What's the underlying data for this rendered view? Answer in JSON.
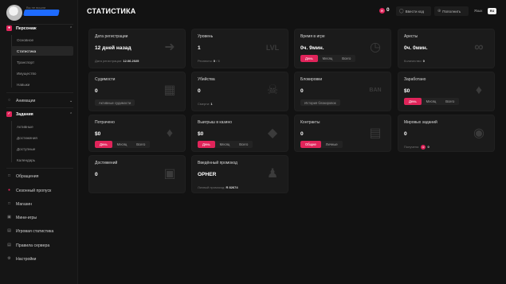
{
  "profile": {
    "status": "Вы не вошли"
  },
  "sidebar": {
    "groups": [
      {
        "label": "Персонаж",
        "icon": "user-icon",
        "expanded": true,
        "items": [
          "Основное",
          "Статистика",
          "Транспорт",
          "Имущество",
          "Навыки"
        ],
        "selected": "Статистика"
      },
      {
        "label": "Анимации",
        "icon": "animation-icon",
        "expanded": false
      },
      {
        "label": "Задания",
        "icon": "tasks-icon",
        "expanded": true,
        "items": [
          "Активные",
          "Достижения",
          "Доступные",
          "Календарь"
        ]
      },
      {
        "label": "Обращения",
        "icon": "ticket-icon"
      },
      {
        "label": "Сезонный пропуск",
        "icon": "pass-icon"
      },
      {
        "label": "Магазин",
        "icon": "shop-icon"
      },
      {
        "label": "Мини-игры",
        "icon": "gamepad-icon"
      },
      {
        "label": "Игровая статистика",
        "icon": "stats-icon"
      },
      {
        "label": "Правила сервера",
        "icon": "rules-icon"
      },
      {
        "label": "Настройки",
        "icon": "settings-icon"
      }
    ]
  },
  "header": {
    "title": "СТАТИСТИКА",
    "coins": "0",
    "coin_symbol": "R",
    "redeem_button": "Ввести код",
    "topup_button": "Пополнить",
    "language_label": "Язык",
    "language_value": "RU"
  },
  "cards": {
    "registration": {
      "title": "Дата регистрации",
      "value": "12 дней назад",
      "meta_label": "Дата регистрации:",
      "meta_value": "12.06.2025"
    },
    "level": {
      "title": "Уровень",
      "value": "1",
      "meta_label": "Респекты:",
      "meta_value": "0",
      "meta_total": "/ 8"
    },
    "playtime": {
      "title": "Время в игре",
      "value": "0ч. 9мин.",
      "tabs": [
        "День",
        "Месяц",
        "Всего"
      ],
      "active_tab": "День"
    },
    "arrests": {
      "title": "Аресты",
      "value": "0ч. 0мин.",
      "meta_label": "Количество:",
      "meta_value": "0"
    },
    "convictions": {
      "title": "Судимости",
      "value": "0",
      "button": "Активные судимости"
    },
    "kills": {
      "title": "Убийства",
      "value": "0",
      "meta_label": "Смерти:",
      "meta_value": "1"
    },
    "bans": {
      "title": "Блокировки",
      "value": "0",
      "button": "История блокировок"
    },
    "earned": {
      "title": "Заработано",
      "value": "$0",
      "tabs": [
        "День",
        "Месяц",
        "Всего"
      ],
      "active_tab": "День"
    },
    "spent": {
      "title": "Потрачено",
      "value": "$0",
      "tabs": [
        "День",
        "Месяц",
        "Всего"
      ],
      "active_tab": "День"
    },
    "casino": {
      "title": "Выигрыш в казино",
      "value": "$0",
      "tabs": [
        "День",
        "Месяц",
        "Всего"
      ],
      "active_tab": "День"
    },
    "contracts": {
      "title": "Контракты",
      "value": "0",
      "tabs": [
        "Общие",
        "Личные"
      ],
      "active_tab": "Общие"
    },
    "world_tasks": {
      "title": "Мировых заданий",
      "value": "0",
      "meta_label": "Получено:",
      "meta_value": "0"
    },
    "achievements": {
      "title": "Достижений",
      "value": "0"
    },
    "promo": {
      "title": "Введённый промокод",
      "value": "OPHER",
      "meta_label": "Личный промокод:",
      "meta_value": "R 82674"
    }
  }
}
